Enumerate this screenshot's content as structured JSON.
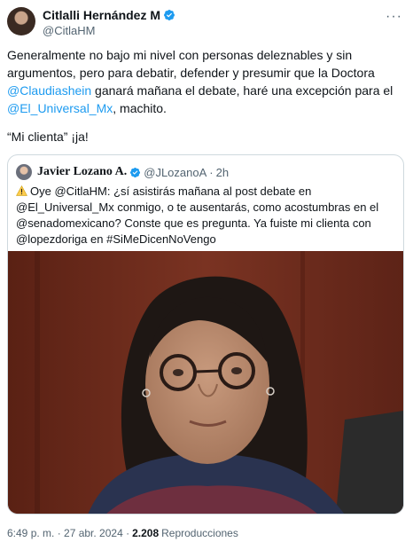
{
  "author": {
    "name": "Citlalli Hernández M",
    "handle": "@CitlaHM"
  },
  "tweet": {
    "text_part1": "Generalmente no bajo mi nivel  con personas deleznables y sin argumentos, pero para debatir, defender y presumir que la Doctora ",
    "mention1": "@Claudiashein",
    "text_part2": " ganará mañana el debate, haré una excepción para el ",
    "mention2": "@El_Universal_Mx",
    "text_part3": ", machito.",
    "line2": "“Mi clienta” ¡ja!"
  },
  "quoted": {
    "name": "Javier Lozano A.",
    "handle": "@JLozanoA",
    "separator": "·",
    "time": "2h",
    "text": "Oye @CitlaHM: ¿sí asistirás mañana al post debate en @El_Universal_Mx conmigo, o te ausentarás, como acostumbras en el @senadomexicano? Conste que es pregunta. Ya fuiste mi clienta con @lopezdoriga en #SiMeDicenNoVengo"
  },
  "footer": {
    "time": "6:49 p. m. · 27 abr. 2024 ·",
    "views_count": "2.208",
    "views_label": "Reproducciones"
  },
  "colors": {
    "link": "#1d9bf0",
    "verified": "#1d9bf0",
    "secondary_text": "#536471"
  },
  "icons": {
    "more": "more-icon",
    "verified": "verified-badge-icon",
    "warning": "warning-icon"
  }
}
